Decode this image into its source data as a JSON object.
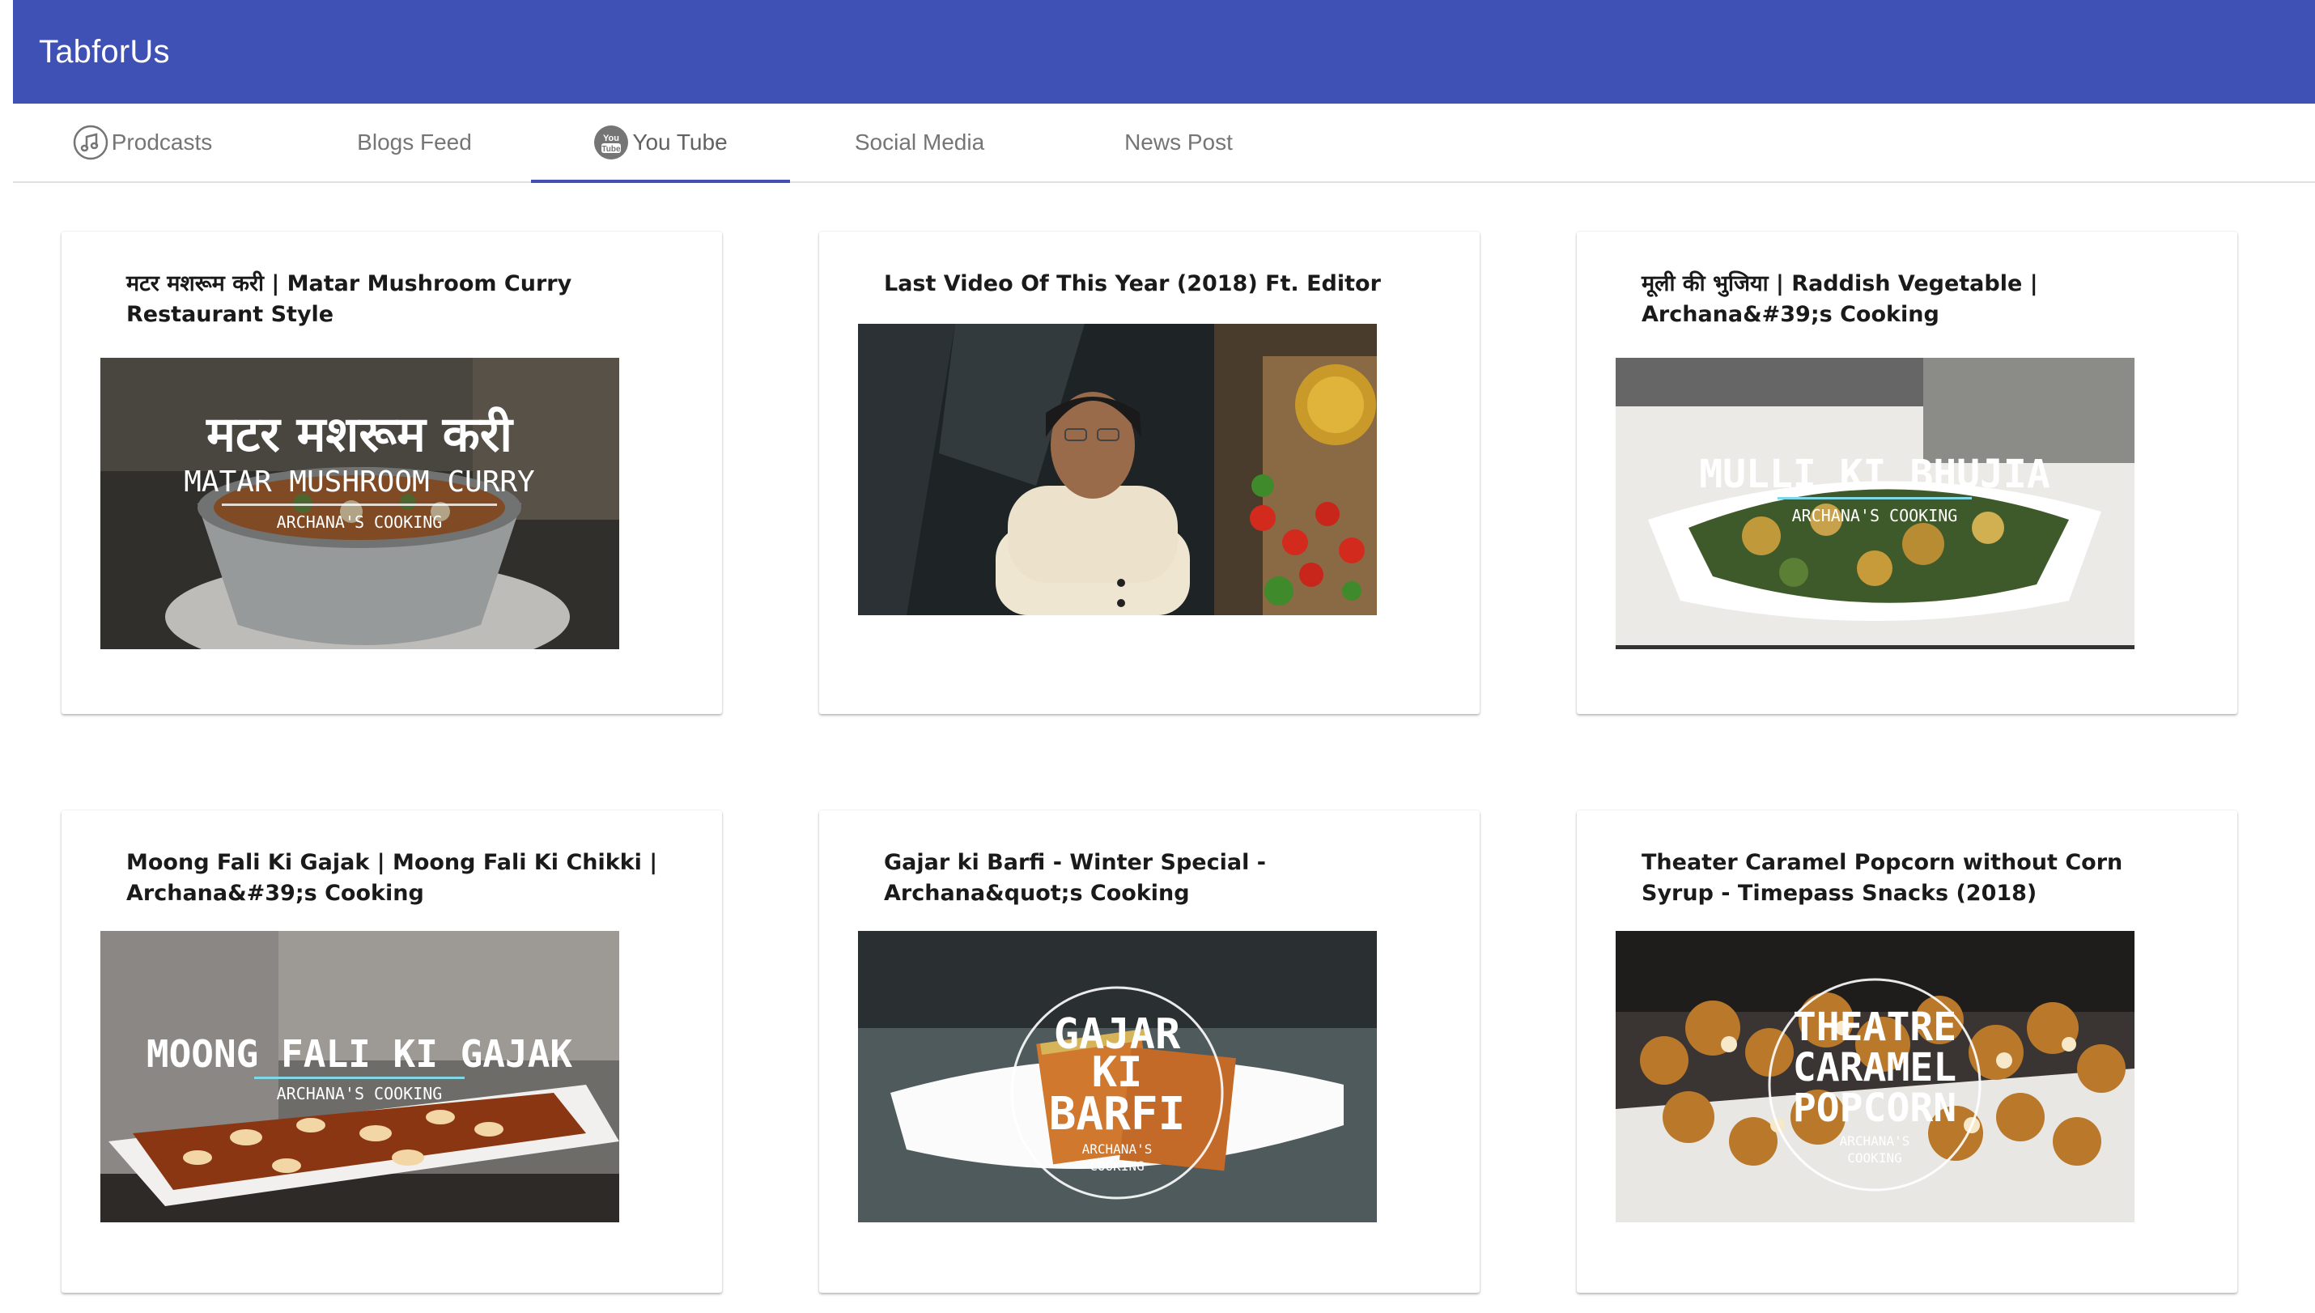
{
  "app": {
    "title": "TabforUs"
  },
  "tabs": [
    {
      "label": "Prodcasts",
      "icon": "music-note-icon",
      "active": false
    },
    {
      "label": "Blogs Feed",
      "active": false
    },
    {
      "label": "You Tube",
      "icon": "youtube-icon",
      "active": true
    },
    {
      "label": "Social Media",
      "active": false
    },
    {
      "label": "News Post",
      "active": false
    }
  ],
  "colors": {
    "appbar": "#3f51b5",
    "indicator": "#3f51b5",
    "tab_text": "#757575"
  },
  "videos": [
    {
      "title": "मटर मशरूम करी | Matar Mushroom Curry Restaurant Style",
      "thumb": {
        "line1": "मटर मशरूम करी",
        "line2": "MATAR MUSHROOM CURRY",
        "line3": "ARCHANA'S COOKING"
      }
    },
    {
      "title": "Last Video Of This Year (2018) Ft. Editor",
      "thumb": {}
    },
    {
      "title": "मूली की भुजिया | Raddish Vegetable | Archana&#39;s Cooking",
      "thumb": {
        "line1": "MULLI KI BHUJIA",
        "line2": "ARCHANA'S COOKING"
      }
    },
    {
      "title": "Moong Fali Ki Gajak | Moong Fali Ki Chikki | Archana&#39;s Cooking",
      "thumb": {
        "line1": "MOONG FALI KI GAJAK",
        "line2": "ARCHANA'S COOKING"
      }
    },
    {
      "title": "Gajar ki Barfi - Winter Special - Archana&quot;s Cooking",
      "thumb": {
        "line1": "GAJAR",
        "line2": "KI",
        "line3": "BARFI",
        "line4": "ARCHANA'S",
        "line5": "COOKING"
      }
    },
    {
      "title": "Theater Caramel Popcorn without Corn Syrup - Timepass Snacks (2018)",
      "thumb": {
        "line1": "THEATRE",
        "line2": "CARAMEL",
        "line3": "POPCORN",
        "line4": "ARCHANA'S",
        "line5": "COOKING"
      }
    }
  ]
}
